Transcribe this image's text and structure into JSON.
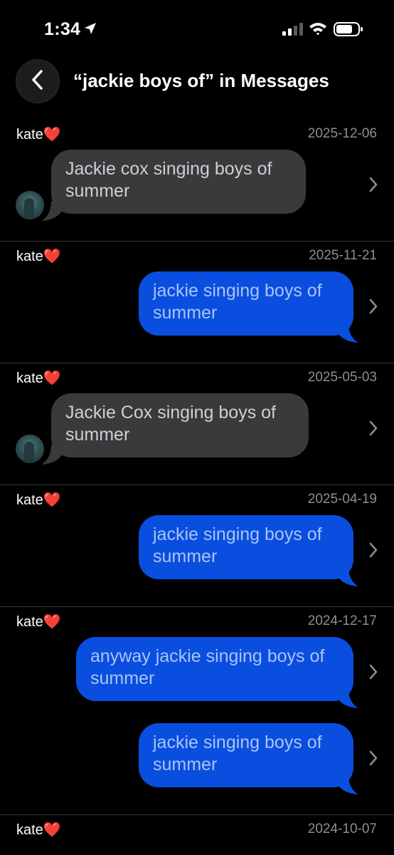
{
  "status_bar": {
    "time": "1:34",
    "icons": [
      "location-arrow-icon",
      "cellular-signal-icon",
      "wifi-icon",
      "battery-icon"
    ]
  },
  "header": {
    "title": "“jackie boys of” in Messages",
    "back_icon": "chevron-left-icon"
  },
  "colors": {
    "background": "#000000",
    "incoming_bubble": "#3a3a3c",
    "outgoing_bubble": "#0a4ee0",
    "date_text": "#8e8e93"
  },
  "results": [
    {
      "sender": "kate❤️",
      "date": "2025-12-06",
      "messages": [
        {
          "direction": "incoming",
          "text": "Jackie cox singing boys of summer"
        }
      ]
    },
    {
      "sender": "kate❤️",
      "date": "2025-11-21",
      "messages": [
        {
          "direction": "outgoing",
          "text": "jackie singing boys of summer"
        }
      ]
    },
    {
      "sender": "kate❤️",
      "date": "2025-05-03",
      "messages": [
        {
          "direction": "incoming",
          "text": "Jackie Cox singing boys of summer"
        }
      ]
    },
    {
      "sender": "kate❤️",
      "date": "2025-04-19",
      "messages": [
        {
          "direction": "outgoing",
          "text": "jackie singing boys of summer"
        }
      ]
    },
    {
      "sender": "kate❤️",
      "date": "2024-12-17",
      "messages": [
        {
          "direction": "outgoing",
          "text": "anyway jackie singing boys of summer"
        },
        {
          "direction": "outgoing",
          "text": "jackie singing boys of summer"
        }
      ]
    },
    {
      "sender": "kate❤️",
      "date": "2024-10-07",
      "messages": []
    }
  ]
}
